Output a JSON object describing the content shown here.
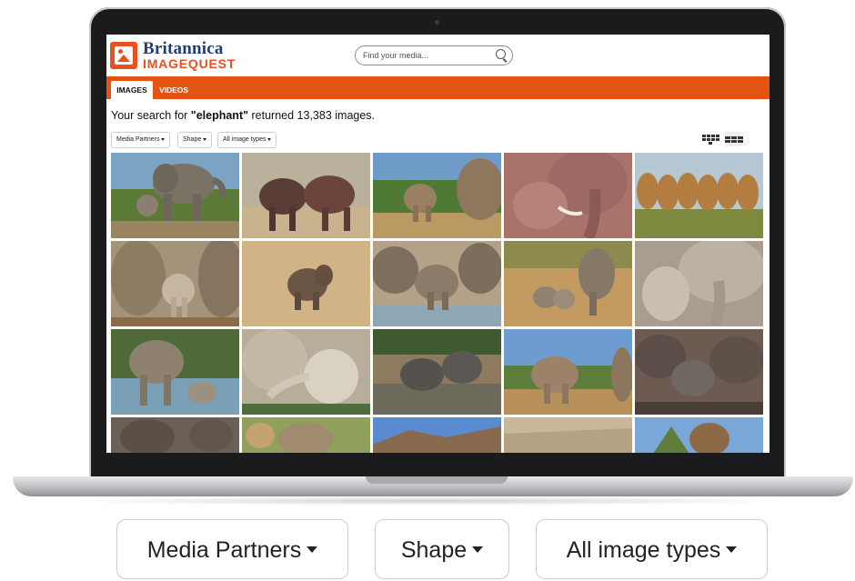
{
  "header": {
    "logo_line1": "Britannica",
    "logo_line2": "IMAGEQUEST",
    "search_placeholder": "Find your media..."
  },
  "tabs": [
    {
      "label": "IMAGES",
      "active": true
    },
    {
      "label": "VIDEOS",
      "active": false
    }
  ],
  "results": {
    "prefix": "Your search for ",
    "query": "\"elephant\"",
    "suffix": " returned 13,383 images."
  },
  "filters": [
    {
      "label": "Media Partners"
    },
    {
      "label": "Shape"
    },
    {
      "label": "All image types"
    }
  ],
  "view_options": [
    "grid-view-icon",
    "tile-view-icon"
  ],
  "colors": {
    "brand_orange": "#e35414",
    "brand_blue": "#1c3f7a"
  },
  "zoomed_filters": [
    {
      "label": "Media Partners"
    },
    {
      "label": "Shape"
    },
    {
      "label": "All image types"
    }
  ]
}
